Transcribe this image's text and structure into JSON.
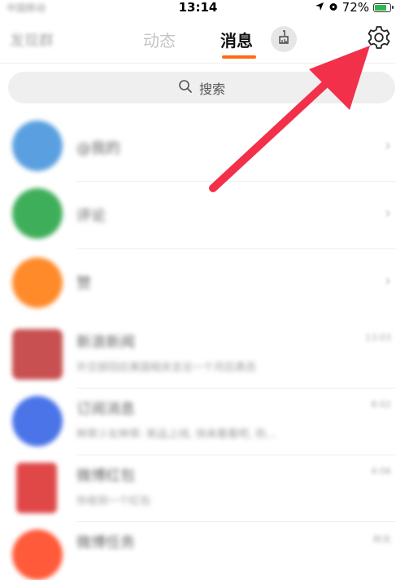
{
  "status": {
    "carrier": "中国移动",
    "time": "13:14",
    "battery": "72%",
    "battery_level": 0.72
  },
  "header": {
    "left_label": "发现群",
    "tabs": [
      {
        "label": "动态",
        "active": false
      },
      {
        "label": "消息",
        "active": true
      }
    ],
    "accent_color": "#ff6a14",
    "broom_icon": "broom-icon",
    "settings_icon": "gear-icon"
  },
  "search": {
    "placeholder": "搜索",
    "icon": "search-icon"
  },
  "rows": [
    {
      "title": "@我的",
      "subtitle": "",
      "time": "",
      "chevron": true,
      "color": "#5aa0e0"
    },
    {
      "title": "评论",
      "subtitle": "",
      "time": "",
      "chevron": true,
      "color": "#3fae5a"
    },
    {
      "title": "赞",
      "subtitle": "",
      "time": "",
      "chevron": true,
      "color": "#ff8a2a"
    },
    {
      "title": "新浪新闻",
      "subtitle": "外交部回应美国相关言论一个月后表态",
      "time": "13:03",
      "chevron": false,
      "color": "#c85050"
    },
    {
      "title": "订阅消息",
      "subtitle": "种草少女种草: 新品上线, 快来看看吧, 热...",
      "time": "8:02",
      "chevron": false,
      "color": "#4a74e8"
    },
    {
      "title": "微博红包",
      "subtitle": "你收到一个红包",
      "time": "4:06",
      "chevron": false,
      "color": "#e04848"
    },
    {
      "title": "微博任务",
      "subtitle": "",
      "time": "昨天",
      "chevron": false,
      "color": "#ff5a3a"
    }
  ],
  "annotation": {
    "arrow_color": "#f2304a"
  }
}
